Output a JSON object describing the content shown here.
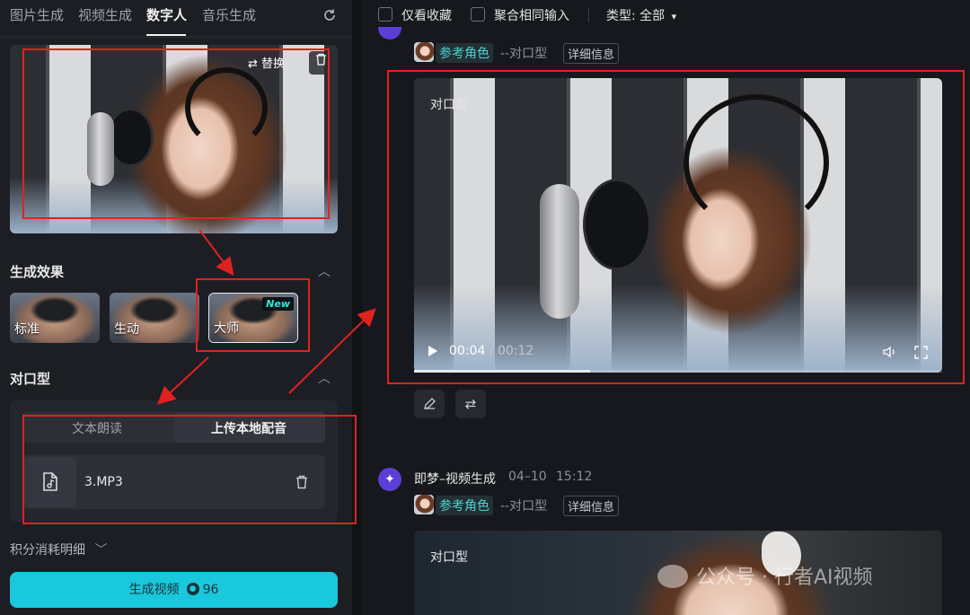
{
  "left_panel": {
    "tabs": [
      "图片生成",
      "视频生成",
      "数字人",
      "音乐生成"
    ],
    "active_tab_index": 2,
    "reference_image": {
      "replace_label": "替换"
    },
    "effect_section": {
      "title": "生成效果",
      "options": [
        "标准",
        "生动",
        "大师"
      ],
      "selected": "大师",
      "new_badge": "New"
    },
    "lipsync_section": {
      "title": "对口型",
      "mode_tabs": [
        "文本朗读",
        "上传本地配音"
      ],
      "active_mode": "上传本地配音",
      "file_name": "3.MP3"
    },
    "cost_detail_label": "积分消耗明细",
    "generate_button": {
      "label": "生成视频",
      "cost": "96"
    }
  },
  "right_panel": {
    "filters": {
      "only_favorites_label": "仅看收藏",
      "merge_same_input_label": "聚合相同输入",
      "type_filter_label": "类型: 全部"
    },
    "result_1": {
      "ref_role": "参考角色",
      "ref_mode": "--对口型",
      "detail_label": "详细信息",
      "video_tag": "对口型",
      "current_time": "00:04",
      "time_separator": "/",
      "total_time": "00:12",
      "progress": 0.333
    },
    "result_2": {
      "app_name": "即梦–视频生成",
      "date": "04–10",
      "time": "15:12",
      "ref_role": "参考角色",
      "ref_mode": "--对口型",
      "detail_label": "详细信息",
      "video_tag": "对口型"
    },
    "watermark": "公众号 · 行者AI视频"
  },
  "colors": {
    "accent_cyan": "#19c8dc",
    "annotation_red": "#e0221f",
    "new_badge_text": "#2ee6d8",
    "role_tag_text": "#4ad3d0",
    "app_avatar": "#5b3fd6"
  },
  "icons": {
    "refresh": "refresh-icon",
    "replace": "swap-icon",
    "delete": "trash-icon",
    "chevron_up": "chevron-up-icon",
    "chevron_down": "chevron-down-icon",
    "audio_file": "audio-file-icon",
    "coin": "coin-icon",
    "play": "play-icon",
    "volume": "volume-icon",
    "fullscreen": "fullscreen-icon",
    "edit": "pencil-icon",
    "regenerate": "regenerate-icon",
    "app_logo": "sparkle-icon"
  }
}
